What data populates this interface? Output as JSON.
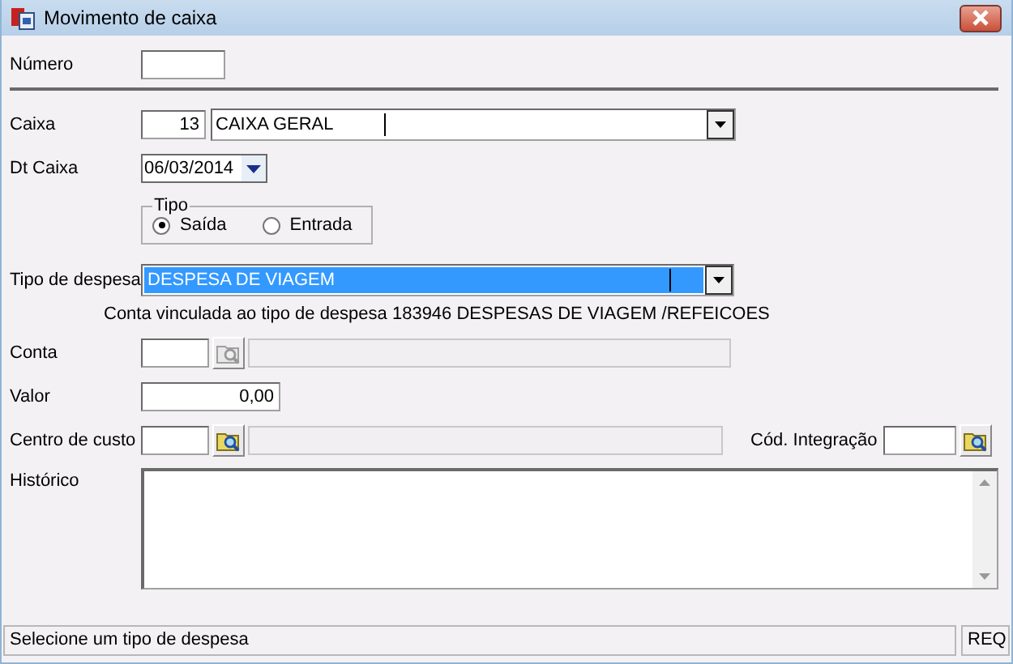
{
  "window": {
    "title": "Movimento de caixa"
  },
  "numero": {
    "label": "Número"
  },
  "caixa": {
    "label": "Caixa",
    "code": "13",
    "value": "CAIXA GERAL"
  },
  "dt_caixa": {
    "label": "Dt Caixa",
    "value": "06/03/2014"
  },
  "tipo": {
    "legend": "Tipo",
    "options": [
      {
        "label": "Saída",
        "selected": true
      },
      {
        "label": "Entrada",
        "selected": false
      }
    ]
  },
  "tipo_despesa": {
    "label": "Tipo de despesa",
    "value": "DESPESA DE VIAGEM",
    "highlighted": true
  },
  "conta_info": "Conta vinculada ao tipo de despesa  183946  DESPESAS DE VIAGEM /REFEICOES",
  "conta": {
    "label": "Conta",
    "lookup_disabled": true,
    "name_disabled": true
  },
  "valor": {
    "label": "Valor",
    "value": "0,00"
  },
  "centro_custo": {
    "label": "Centro de custo",
    "lookup_disabled": false,
    "name_disabled": true
  },
  "cod_integracao": {
    "label": "Cód. Integração",
    "lookup_disabled": false
  },
  "historico": {
    "label": "Histórico"
  },
  "status_bar": {
    "message": "Selecione um tipo de despesa",
    "indicator": "REQ"
  }
}
